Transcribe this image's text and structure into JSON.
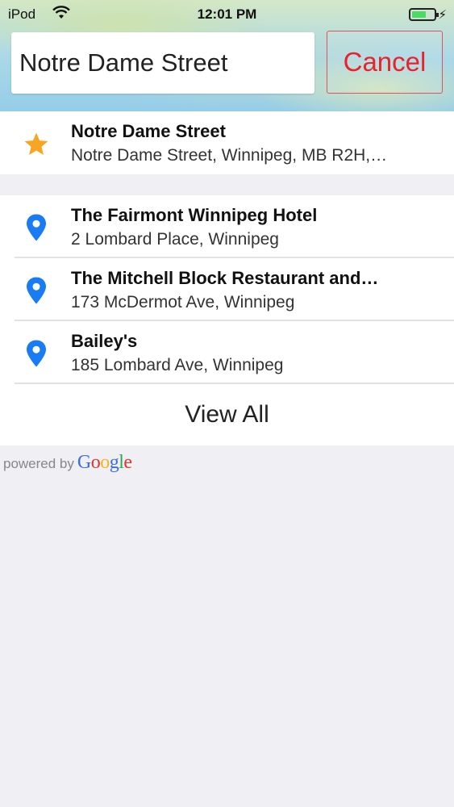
{
  "status_bar": {
    "carrier": "iPod",
    "time": "12:01 PM"
  },
  "search": {
    "value": "Notre Dame Street",
    "cancel_label": "Cancel"
  },
  "suggestion": {
    "icon": "star-icon",
    "title": "Notre Dame Street",
    "subtitle": "Notre Dame Street, Winnipeg, MB R2H,…"
  },
  "results": [
    {
      "icon": "map-pin-icon",
      "title": "The Fairmont Winnipeg Hotel",
      "subtitle": "2 Lombard Place, Winnipeg"
    },
    {
      "icon": "map-pin-icon",
      "title": "The Mitchell Block Restaurant and…",
      "subtitle": "173 McDermot Ave, Winnipeg"
    },
    {
      "icon": "map-pin-icon",
      "title": "Bailey's",
      "subtitle": "185 Lombard Ave, Winnipeg"
    }
  ],
  "view_all_label": "View All",
  "attribution": {
    "prefix": "powered by",
    "logo_letters": [
      "G",
      "o",
      "o",
      "g",
      "l",
      "e"
    ],
    "logo_colors": [
      "#3b6fe0",
      "#e1342a",
      "#f2b51b",
      "#3b6fe0",
      "#2fa84f",
      "#e1342a"
    ]
  },
  "colors": {
    "accent_red": "#e8232e",
    "pin_blue": "#1a7cf5",
    "star_orange": "#f6a623"
  }
}
